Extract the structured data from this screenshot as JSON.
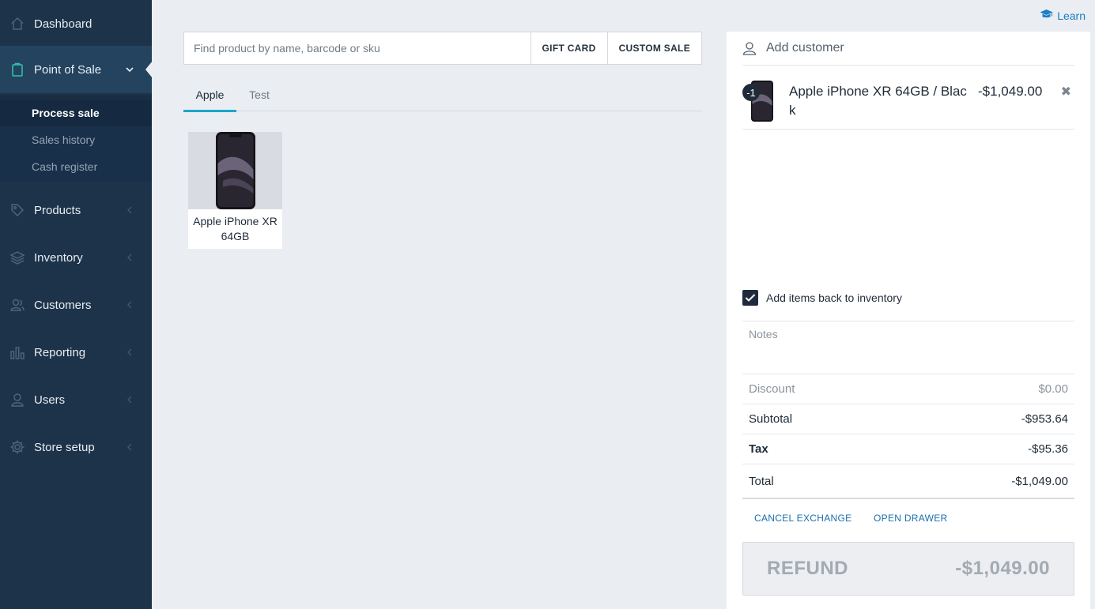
{
  "sidebar": {
    "items": [
      {
        "label": "Dashboard",
        "icon": "home-icon"
      },
      {
        "label": "Point of Sale",
        "icon": "clipboard-icon"
      },
      {
        "label": "Products",
        "icon": "tag-icon"
      },
      {
        "label": "Inventory",
        "icon": "layers-icon"
      },
      {
        "label": "Customers",
        "icon": "users-icon"
      },
      {
        "label": "Reporting",
        "icon": "bar-chart-icon"
      },
      {
        "label": "Users",
        "icon": "user-icon"
      },
      {
        "label": "Store setup",
        "icon": "gear-icon"
      }
    ],
    "subitems": [
      {
        "label": "Process sale"
      },
      {
        "label": "Sales history"
      },
      {
        "label": "Cash register"
      }
    ]
  },
  "header": {
    "learn_label": "Learn"
  },
  "search": {
    "placeholder": "Find product by name, barcode or sku",
    "gift_card_label": "GIFT CARD",
    "custom_sale_label": "CUSTOM SALE"
  },
  "tabs": [
    {
      "label": "Apple"
    },
    {
      "label": "Test"
    }
  ],
  "products": [
    {
      "name": "Apple iPhone XR 64GB"
    }
  ],
  "cart": {
    "add_customer_label": "Add customer",
    "line_items": [
      {
        "qty": "-1",
        "name": "Apple iPhone XR 64GB / Black",
        "price": "-$1,049.00"
      }
    ],
    "add_back_label": "Add items back to inventory",
    "notes_placeholder": "Notes",
    "discount": {
      "label": "Discount",
      "value": "$0.00"
    },
    "subtotal": {
      "label": "Subtotal",
      "value": "-$953.64"
    },
    "tax": {
      "label": "Tax",
      "value": "-$95.36"
    },
    "total": {
      "label": "Total",
      "value": "-$1,049.00"
    },
    "cancel_exchange_label": "CANCEL EXCHANGE",
    "open_drawer_label": "OPEN DRAWER",
    "refund_label": "REFUND",
    "refund_amount": "-$1,049.00"
  },
  "colors": {
    "sidebar_bg": "#1d3349",
    "accent": "#1aa8c9",
    "link": "#1a7fc4",
    "active_icon": "#2fc4b2"
  }
}
